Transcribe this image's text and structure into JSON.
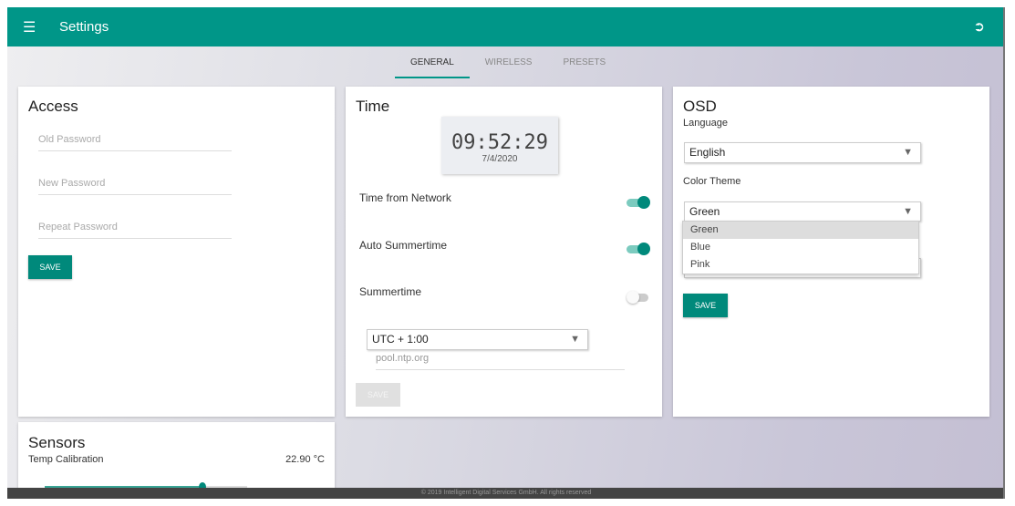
{
  "header": {
    "title": "Settings",
    "menu_icon": "menu-icon",
    "logout_icon": "logout-icon"
  },
  "tabs": [
    {
      "label": "GENERAL",
      "active": true
    },
    {
      "label": "WIRELESS",
      "active": false
    },
    {
      "label": "PRESETS",
      "active": false
    }
  ],
  "access": {
    "title": "Access",
    "old_password_placeholder": "Old Password",
    "new_password_placeholder": "New Password",
    "repeat_password_placeholder": "Repeat Password",
    "save_label": "SAVE"
  },
  "time": {
    "title": "Time",
    "clock_time": "09:52:29",
    "clock_date": "7/4/2020",
    "time_from_network_label": "Time from Network",
    "time_from_network": true,
    "auto_summertime_label": "Auto Summertime",
    "auto_summertime": true,
    "summertime_label": "Summertime",
    "summertime": false,
    "timezone": "UTC + 1:00",
    "ntp_server": "pool.ntp.org",
    "save_label": "SAVE"
  },
  "osd": {
    "title": "OSD",
    "language_label": "Language",
    "language": "English",
    "color_theme_label": "Color Theme",
    "color_theme": "Green",
    "color_theme_options": [
      "Green",
      "Blue",
      "Pink"
    ],
    "save_label": "SAVE"
  },
  "sensors": {
    "title": "Sensors",
    "temp_calibration_label": "Temp Calibration",
    "temp_calibration_value": "22.90 °C",
    "slider_fraction": 0.78
  },
  "footer": {
    "text": "© 2019 Intelligent Digital Services GmbH. All rights reserved"
  },
  "colors": {
    "primary": "#009688"
  }
}
